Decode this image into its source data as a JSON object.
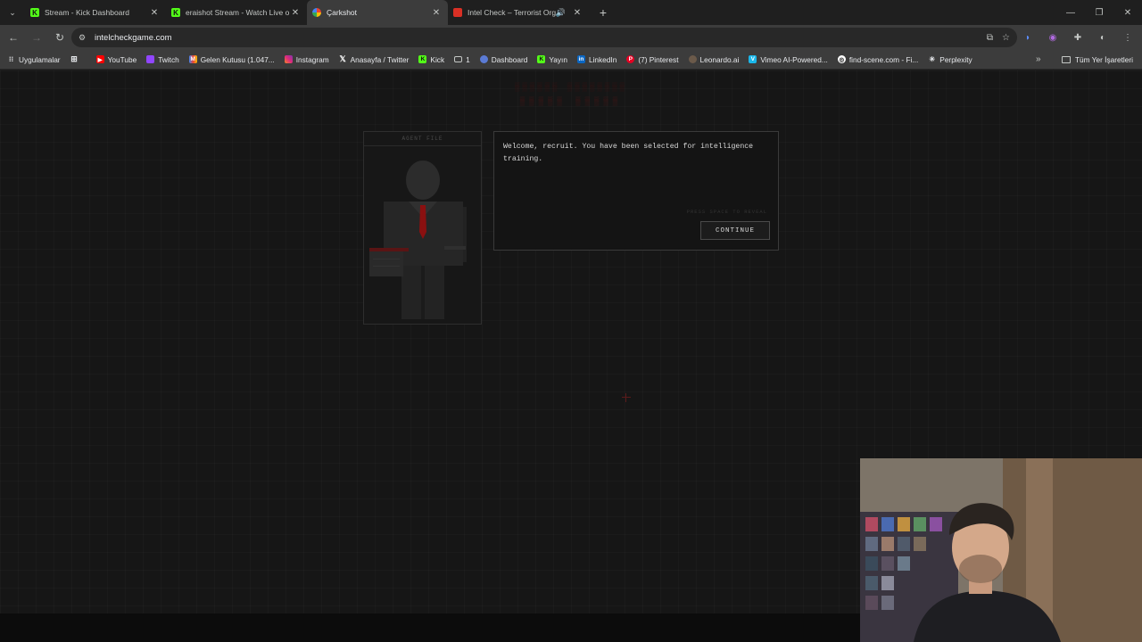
{
  "browser": {
    "tabs": [
      {
        "title": "Stream - Kick Dashboard",
        "favicon": "kick-icon",
        "active": false
      },
      {
        "title": "eraishot Stream - Watch Live on",
        "favicon": "kick-icon",
        "active": false
      },
      {
        "title": "Çarkshot",
        "favicon": "wheel-icon",
        "active": true
      },
      {
        "title": "Intel Check – Terrorist Orga",
        "favicon": "intelcheck-icon",
        "active": false,
        "audio": true
      }
    ],
    "url": "intelcheckgame.com",
    "bookmarks": [
      {
        "label": "Uygulamalar",
        "icon": "apps-grid-icon"
      },
      {
        "label": "",
        "icon": "grid-icon"
      },
      {
        "label": "YouTube",
        "icon": "youtube-icon"
      },
      {
        "label": "Twitch",
        "icon": "twitch-icon"
      },
      {
        "label": "Gelen Kutusu (1.047...",
        "icon": "gmail-icon"
      },
      {
        "label": "Instagram",
        "icon": "instagram-icon"
      },
      {
        "label": "Anasayfa / Twitter",
        "icon": "x-icon"
      },
      {
        "label": "Kick",
        "icon": "kick-icon"
      },
      {
        "label": "1",
        "icon": "folder-icon"
      },
      {
        "label": "Dashboard",
        "icon": "globe-icon"
      },
      {
        "label": "Yayın",
        "icon": "kick-icon"
      },
      {
        "label": "LinkedIn",
        "icon": "linkedin-icon"
      },
      {
        "label": "(7) Pinterest",
        "icon": "pinterest-icon"
      },
      {
        "label": "Leonardo.ai",
        "icon": "leonardo-icon"
      },
      {
        "label": "Vimeo AI-Powered...",
        "icon": "vimeo-icon"
      },
      {
        "label": "find-scene.com - Fi...",
        "icon": "findscene-icon"
      },
      {
        "label": "Perplexity",
        "icon": "perplexity-icon"
      }
    ],
    "all_bookmarks_label": "Tüm Yer İşaretleri"
  },
  "game": {
    "agent_file_label": "AGENT FILE",
    "dialog_text": "Welcome, recruit. You have been selected for intelligence training.",
    "hint_text": "PRESS SPACE TO REVEAL",
    "continue_label": "CONTINUE"
  },
  "colors": {
    "page_bg": "#161616",
    "tie_red": "#8a1010",
    "title_red": "#3a1212"
  }
}
